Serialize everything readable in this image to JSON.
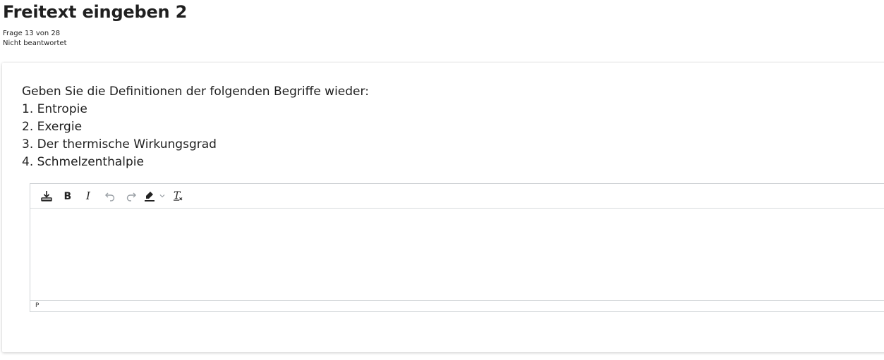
{
  "header": {
    "title": "Freitext eingeben 2",
    "progress": "Frage 13 von 28",
    "status": "Nicht beantwortet"
  },
  "question": {
    "lines": [
      "Geben Sie die Definitionen der folgenden Begriffe wieder:",
      "1. Entropie",
      "2. Exergie",
      "3. Der thermische Wirkungsgrad",
      "4. Schmelzenthalpie"
    ]
  },
  "editor": {
    "toolbar": [
      {
        "name": "download-icon",
        "label": "download"
      },
      {
        "name": "bold-icon",
        "label": "B"
      },
      {
        "name": "italic-icon",
        "label": "I"
      },
      {
        "name": "undo-icon",
        "label": "undo"
      },
      {
        "name": "redo-icon",
        "label": "redo"
      },
      {
        "name": "highlight-icon",
        "label": "highlight"
      },
      {
        "name": "chevron-down-icon",
        "label": "more"
      },
      {
        "name": "clear-format-icon",
        "label": "clear formatting"
      }
    ],
    "content": "",
    "status_path": "P"
  },
  "colors": {
    "text": "#1e1e1e",
    "border": "#cfd3d6",
    "disabled_icon": "#9aa0a6"
  }
}
